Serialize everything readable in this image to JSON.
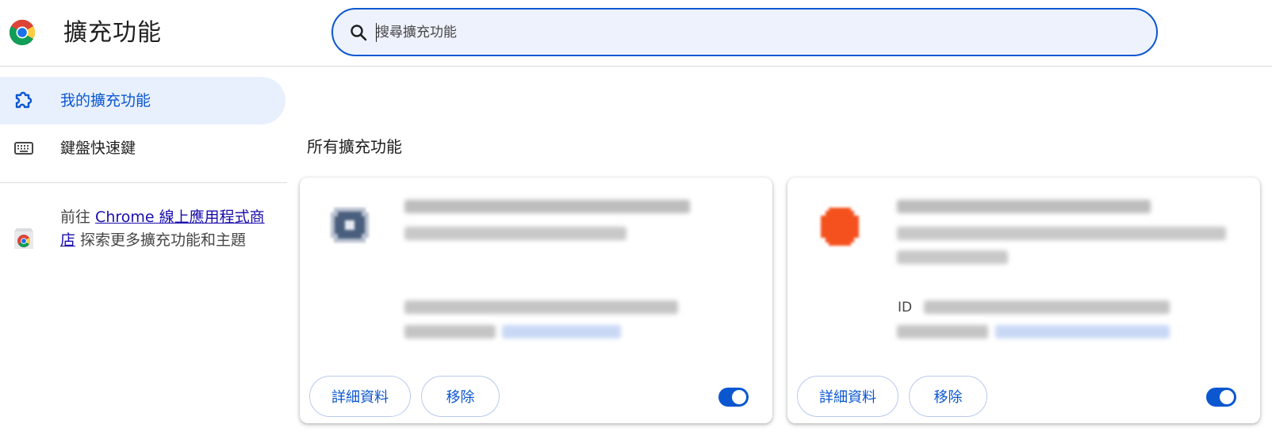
{
  "header": {
    "title": "擴充功能",
    "search": {
      "placeholder": "搜尋擴充功能",
      "value": ""
    },
    "logo_icon": "chrome-logo-icon"
  },
  "sidebar": {
    "items": [
      {
        "label": "我的擴充功能",
        "icon": "puzzle-piece-icon",
        "active": true
      },
      {
        "label": "鍵盤快速鍵",
        "icon": "keyboard-icon",
        "active": false
      }
    ],
    "store": {
      "prefix": "前往 ",
      "link": "Chrome 線上應用程式商店",
      "suffix": " 探索更多擴充功能和主題",
      "icon": "chrome-web-store-icon"
    }
  },
  "main": {
    "section_title": "所有擴充功能",
    "cards": [
      {
        "id_label": "",
        "details_label": "詳細資料",
        "remove_label": "移除",
        "enabled": true,
        "icon": "extension-gear-icon",
        "accent": "#4a5f7e"
      },
      {
        "id_label": "ID",
        "details_label": "詳細資料",
        "remove_label": "移除",
        "enabled": true,
        "icon": "extension-orange-icon",
        "accent": "#f4511e"
      }
    ]
  },
  "colors": {
    "accent": "#0b57d0",
    "active_bg": "#e8f0fe",
    "search_bg": "#edf2fc",
    "link": "#1a0dab"
  }
}
